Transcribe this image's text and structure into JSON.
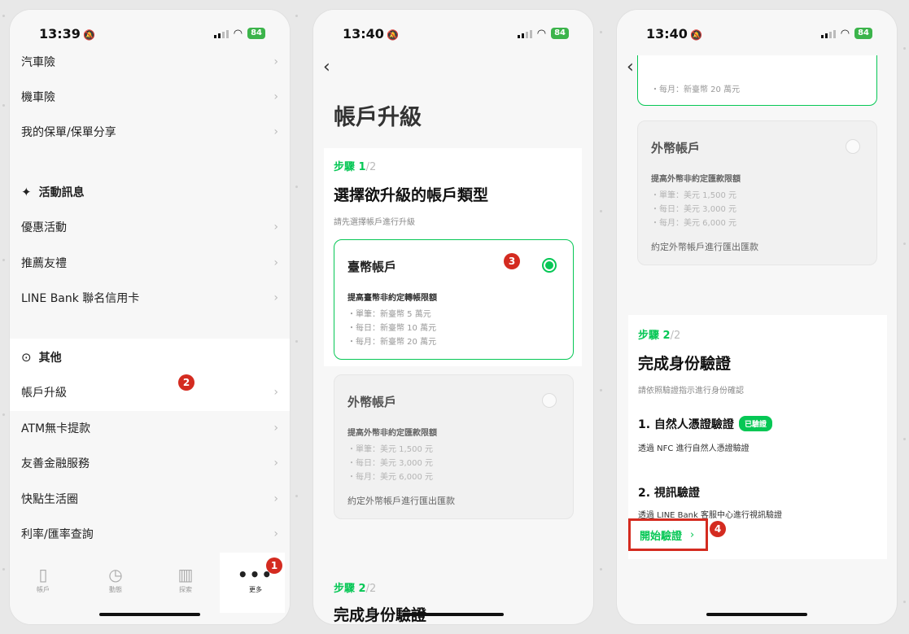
{
  "status_bar": {
    "phone1_time": "13:39",
    "phone2_time": "13:40",
    "phone3_time": "13:40",
    "battery": "84"
  },
  "phone1": {
    "menu_top": [
      "汽車險",
      "機車險",
      "我的保單/保單分享"
    ],
    "events_header": "活動訊息",
    "events_items": [
      "優惠活動",
      "推薦友禮",
      "LINE Bank 聯名信用卡"
    ],
    "other_header": "其他",
    "account_upgrade": "帳戶升級",
    "other_items": [
      "ATM無卡提款",
      "友善金融服務",
      "快點生活圈",
      "利率/匯率查詢"
    ],
    "tabs": [
      "帳戶",
      "動態",
      "探索",
      "更多"
    ],
    "badge_more": "1",
    "badge_upgrade": "2"
  },
  "phone2": {
    "page_title": "帳戶升級",
    "step1_num": "步驟 1",
    "step1_den": "/2",
    "step1_title": "選擇欲升級的帳戶類型",
    "step1_sub": "請先選擇帳戶進行升級",
    "twd_card": {
      "title": "臺幣帳戶",
      "subtitle": "提高臺幣非約定轉帳限額",
      "items": [
        "・單筆：新臺幣 5 萬元",
        "・每日：新臺幣 10 萬元",
        "・每月：新臺幣 20 萬元"
      ]
    },
    "fx_card": {
      "title": "外幣帳戶",
      "subtitle": "提高外幣非約定匯款限額",
      "items": [
        "・單筆：美元 1,500 元",
        "・每日：美元 3,000 元",
        "・每月：美元 6,000 元"
      ],
      "footer": "約定外幣帳戶進行匯出匯款"
    },
    "badge_select": "3",
    "step2_num": "步驟 2",
    "step2_den": "/2",
    "step2_title": "完成身份驗證"
  },
  "phone3": {
    "prev_line": "・每月：新臺幣 20 萬元",
    "fx_card": {
      "title": "外幣帳戶",
      "subtitle": "提高外幣非約定匯款限額",
      "items": [
        "・單筆：美元 1,500 元",
        "・每日：美元 3,000 元",
        "・每月：美元 6,000 元"
      ],
      "footer": "約定外幣帳戶進行匯出匯款"
    },
    "step2_num": "步驟 2",
    "step2_den": "/2",
    "step2_title": "完成身份驗證",
    "step2_sub": "請依照驗證指示進行身份確認",
    "cert_title": "1. 自然人憑證驗證",
    "cert_tag": "已驗證",
    "cert_desc": "透過 NFC 進行自然人憑證驗證",
    "video_title": "2. 視訊驗證",
    "video_desc": "透過 LINE Bank 客服中心進行視訊驗證",
    "start_label": "開始驗證",
    "badge_start": "4"
  },
  "colors": {
    "accent": "#06c755",
    "badge": "#d42b20"
  }
}
